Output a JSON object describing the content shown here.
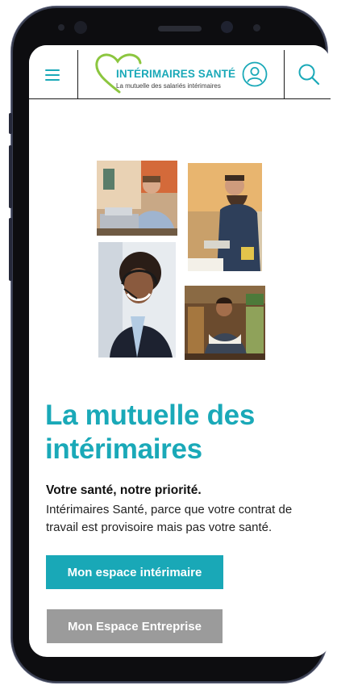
{
  "header": {
    "menu_icon": "hamburger-menu-icon",
    "brand_name": "INTÉRIMAIRES SANTÉ",
    "brand_tagline": "La mutuelle des salariés intérimaires",
    "account_icon": "user-account-icon",
    "search_icon": "search-icon",
    "accent_color": "#1aa9b8"
  },
  "hero": {
    "photos": [
      "man-with-laptop-photo",
      "worker-in-overalls-photo",
      "woman-with-headset-photo",
      "shop-worker-with-apron-photo"
    ]
  },
  "main": {
    "headline": "La mutuelle des intérimaires",
    "subtitle": "Votre santé, notre priorité.",
    "description": "Intérimaires Santé, parce que votre contrat de travail est provisoire mais pas votre santé."
  },
  "actions": {
    "primary_label": "Mon espace intérimaire",
    "secondary_label": "Mon Espace Entreprise",
    "primary_color": "#19a8b7",
    "secondary_color": "#9b9b9b"
  }
}
